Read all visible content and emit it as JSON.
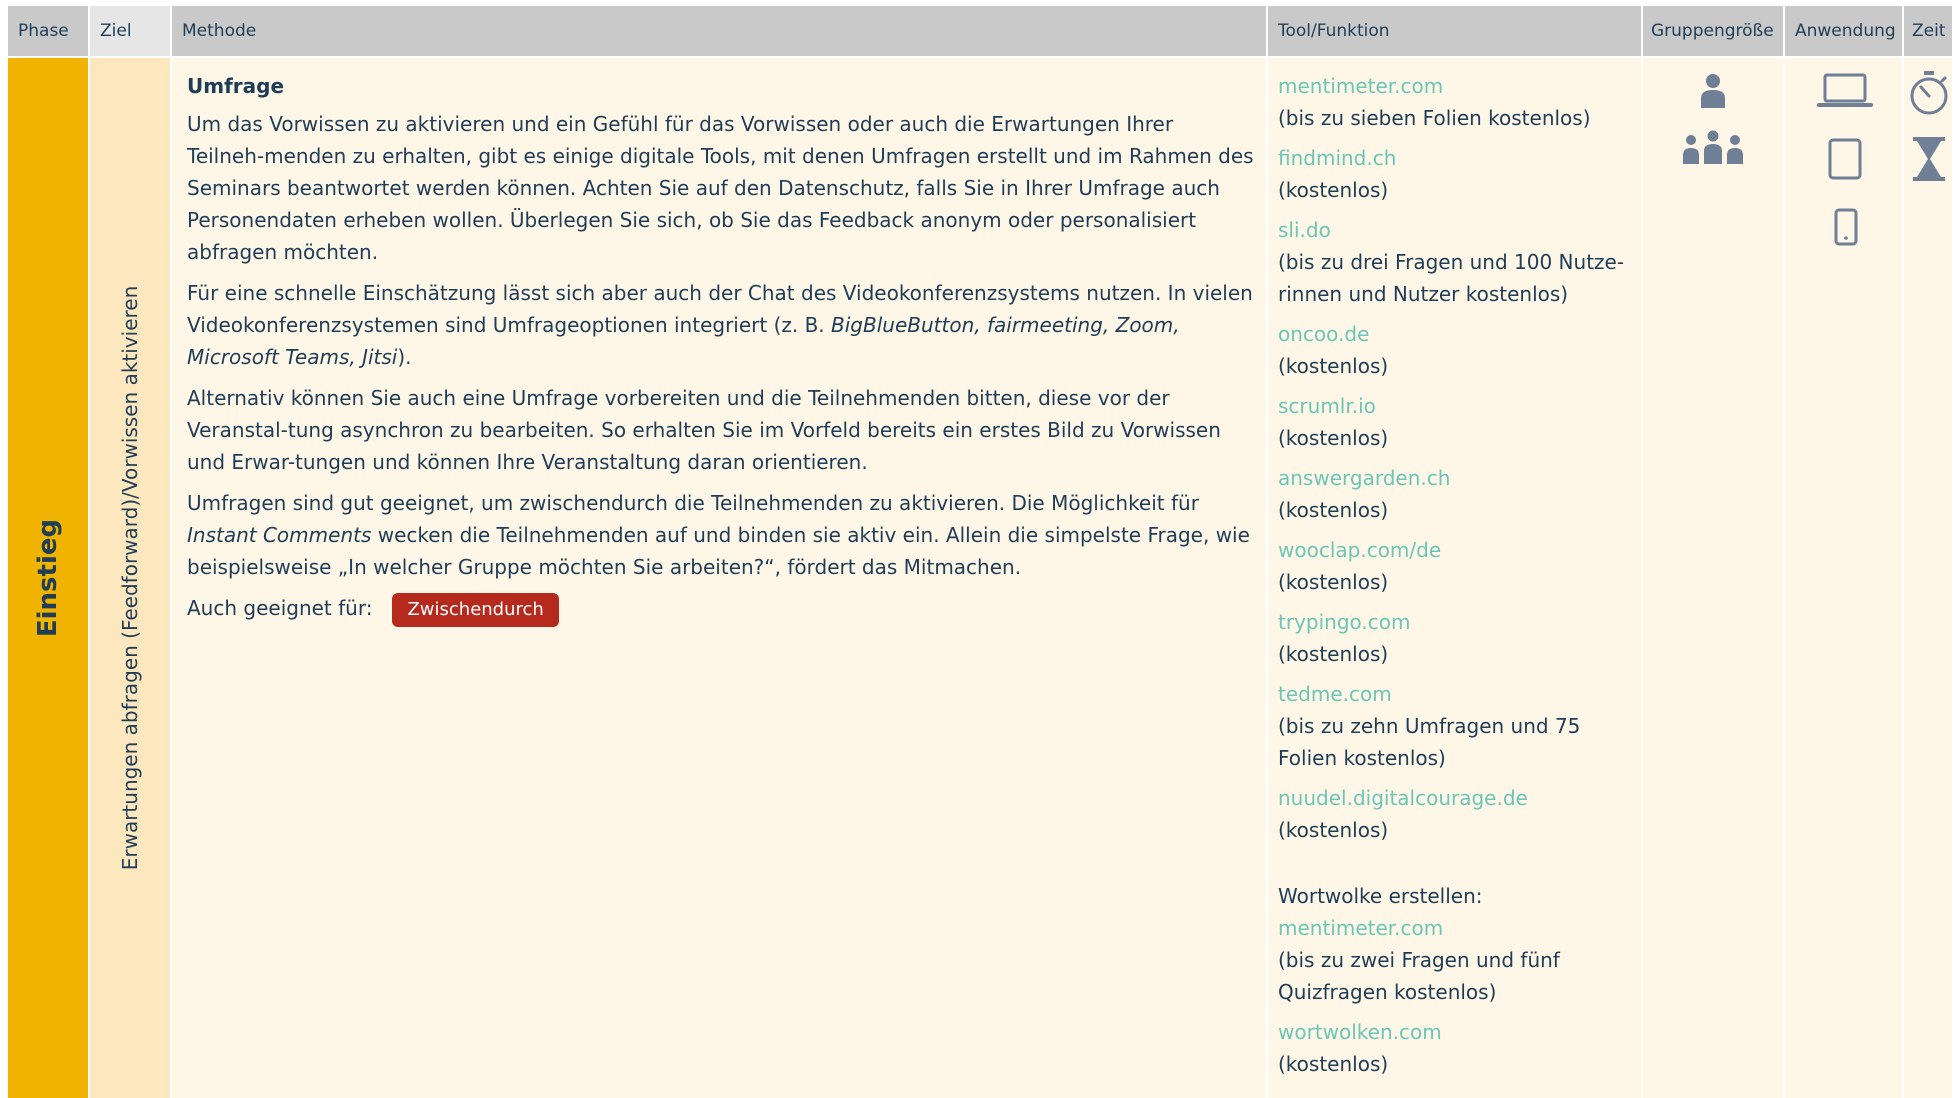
{
  "headers": {
    "phase": "Phase",
    "ziel": "Ziel",
    "methode": "Methode",
    "tool": "Tool/Funktion",
    "gruppe": "Gruppengröße",
    "anwendung": "Anwendung",
    "zeit": "Zeit"
  },
  "phase": "Einstieg",
  "ziel": "Erwartungen abfragen (Feedforward)/Vorwissen aktivieren",
  "methode": {
    "title": "Umfrage",
    "p1": "Um das Vorwissen zu aktivieren und ein Gefühl für das Vorwissen oder auch die Erwartungen Ihrer Teilneh-menden zu erhalten, gibt es einige digitale Tools, mit denen Umfragen erstellt und im Rahmen des Seminars beantwortet werden können. Achten Sie auf den Datenschutz, falls Sie in Ihrer Umfrage auch Personendaten erheben wollen. Überlegen Sie sich, ob Sie das Feedback anonym oder personalisiert abfragen möchten.",
    "p2_start": "Für eine schnelle Einschätzung lässt sich aber auch der Chat des Videokonferenzsystems nutzen. In vielen Videokonferenzsystemen sind Umfrageoptionen integriert (z. B. ",
    "p2_italic": "BigBlueButton, fairmeeting, Zoom, Microsoft Teams, Jitsi",
    "p2_end": ").",
    "p3": "Alternativ können Sie auch eine Umfrage vorbereiten und die Teilnehmenden bitten, diese vor der Veranstal-tung asynchron zu bearbeiten. So erhalten Sie im Vorfeld bereits ein erstes Bild zu Vorwissen und Erwar-tungen und können Ihre Veranstaltung daran orientieren.",
    "p4_start": "Umfragen sind gut geeignet, um zwischendurch die Teilnehmenden zu aktivieren. Die Möglichkeit für ",
    "p4_italic": "Instant Comments",
    "p4_end": " wecken die Teilnehmenden auf und binden sie aktiv ein. Allein die simpelste Frage, wie beispielsweise „In welcher Gruppe möchten Sie arbeiten?“, fördert das Mitmachen.",
    "also_label": "Auch geeignet für:",
    "badge": "Zwischendurch"
  },
  "tools": [
    {
      "link": "mentimeter.com",
      "note": "(bis zu sieben Folien kostenlos)"
    },
    {
      "link": "findmind.ch",
      "note": "(kostenlos)"
    },
    {
      "link": "sli.do",
      "note": "(bis zu drei Fragen und 100 Nutze-rinnen und Nutzer kostenlos)"
    },
    {
      "link": "oncoo.de",
      "note": "(kostenlos)"
    },
    {
      "link": "scrumlr.io",
      "note": "(kostenlos)"
    },
    {
      "link": "answergarden.ch",
      "note": "(kostenlos)"
    },
    {
      "link": "wooclap.com/de",
      "note": "(kostenlos)"
    },
    {
      "link": "trypingo.com",
      "note": "(kostenlos)"
    },
    {
      "link": "tedme.com",
      "note": "(bis zu zehn Umfragen und 75 Folien kostenlos)"
    },
    {
      "link": "nuudel.digitalcourage.de",
      "note": "(kostenlos)"
    }
  ],
  "wortwolke": {
    "label": "Wortwolke erstellen:",
    "items": [
      {
        "link": "mentimeter.com",
        "note": "(bis zu zwei Fragen und fünf Quizfragen kostenlos)"
      },
      {
        "link": "wortwolken.com",
        "note": "(kostenlos)"
      }
    ]
  },
  "icons": {
    "gruppe": [
      "person-icon",
      "group-icon"
    ],
    "anwendung": [
      "laptop-icon",
      "tablet-icon",
      "smartphone-icon"
    ],
    "zeit": [
      "stopwatch-icon",
      "hourglass-icon"
    ]
  },
  "colors": {
    "phase": "#f0b400",
    "ziel": "#fde7bf",
    "cell": "#fef6e6",
    "header": "#c9c9c9",
    "link": "#6cc6b8",
    "badge": "#b52a1c",
    "text": "#1f3d57",
    "icon": "#6f7f96"
  }
}
